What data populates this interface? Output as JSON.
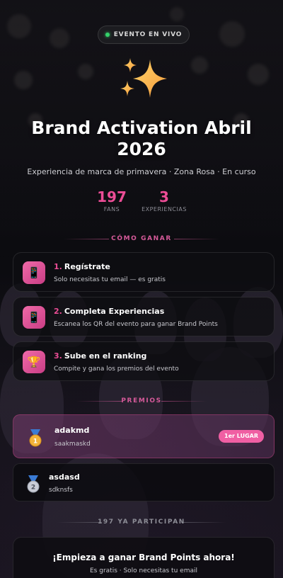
{
  "live_badge": {
    "label": "EVENTO EN VIVO"
  },
  "event": {
    "title": "Brand Activation Abril 2026",
    "subtitle": "Experiencia de marca de primavera · Zona Rosa · En curso",
    "icon": "sparkles-icon"
  },
  "stats": [
    {
      "value": "197",
      "label": "FANS"
    },
    {
      "value": "3",
      "label": "EXPERIENCIAS"
    }
  ],
  "how_to_win": {
    "heading": "CÓMO GANAR",
    "steps": [
      {
        "number": "1.",
        "title": "Regístrate",
        "description": "Solo necesitas tu email — es gratis",
        "icon": "phone-icon"
      },
      {
        "number": "2.",
        "title": "Completa Experiencias",
        "description": "Escanea los QR del evento para ganar Brand Points",
        "icon": "phone-icon"
      },
      {
        "number": "3.",
        "title": "Sube en el ranking",
        "description": "Compite y gana los premios del evento",
        "icon": "trophy-icon"
      }
    ]
  },
  "prizes": {
    "heading": "PREMIOS",
    "items": [
      {
        "name": "adakmd",
        "description": "saakmaskd",
        "medal": "1",
        "badge": "1er LUGAR"
      },
      {
        "name": "asdasd",
        "description": "sdknsfs",
        "medal": "2"
      }
    ]
  },
  "participants": {
    "label": "197 YA PARTICIPAN"
  },
  "cta": {
    "title": "¡Empieza a ganar Brand Points ahora!",
    "subtitle": "Es gratis · Solo necesitas tu email"
  },
  "colors": {
    "accent": "#ec4d96",
    "live": "#34d26a",
    "badge": "#f05fa3"
  }
}
